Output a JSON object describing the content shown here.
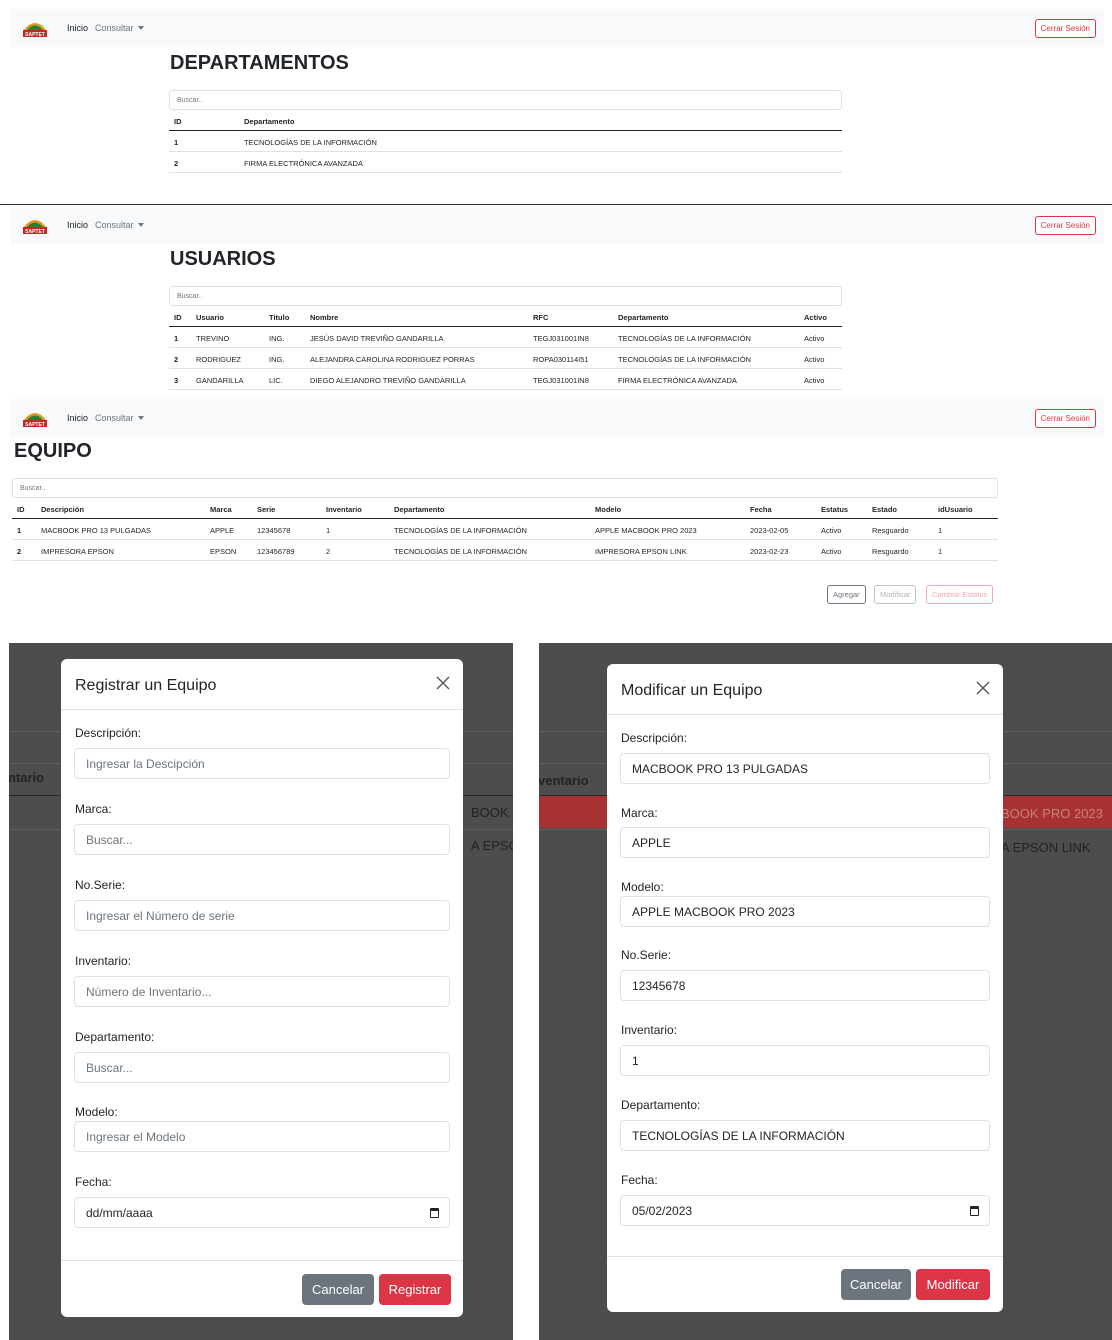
{
  "nav": {
    "logo_text": "SAPTET",
    "home": "Inicio",
    "consult": "Consultar",
    "logout": "Cerrar Sesión"
  },
  "departamentos": {
    "title": "DEPARTAMENTOS",
    "search_placeholder": "Buscar..",
    "headers": [
      "ID",
      "Departamento"
    ],
    "rows": [
      [
        "1",
        "TECNOLOGÍAS DE LA INFORMACIÓN"
      ],
      [
        "2",
        "FIRMA ELECTRÓNICA AVANZADA"
      ]
    ]
  },
  "usuarios": {
    "title": "USUARIOS",
    "search_placeholder": "Buscar..",
    "headers": [
      "ID",
      "Usuario",
      "Titulo",
      "Nombre",
      "RFC",
      "Departamento",
      "Activo"
    ],
    "rows": [
      [
        "1",
        "TREVINO",
        "ING.",
        "JESÚS DAVID TREVIÑO GANDARILLA",
        "TEGJ031001IN8",
        "TECNOLOGÍAS DE LA INFORMACIÓN",
        "Activo"
      ],
      [
        "2",
        "RODRIGUEZ",
        "ING.",
        "ALEJANDRA CAROLINA RODRIGUEZ PORRAS",
        "ROPA030114I51",
        "TECNOLOGÍAS DE LA INFORMACIÓN",
        "Activo"
      ],
      [
        "3",
        "GANDARILLA",
        "LIC.",
        "DIEGO ALEJANDRO TREVIÑO GANDARILLA",
        "TEGJ031001IN8",
        "FIRMA ELECTRÓNICA AVANZADA",
        "Activo"
      ]
    ]
  },
  "equipo": {
    "title": "EQUIPO",
    "search_placeholder": "Buscar..",
    "headers": [
      "ID",
      "Descripción",
      "Marca",
      "Serie",
      "Inventario",
      "Departamento",
      "Modelo",
      "Fecha",
      "Estatus",
      "Estado",
      "idUsuario"
    ],
    "rows": [
      [
        "1",
        "MACBOOK PRO 13 PULGADAS",
        "APPLE",
        "12345678",
        "1",
        "TECNOLOGÍAS DE LA INFORMACIÓN",
        "APPLE MACBOOK PRO 2023",
        "2023-02-05",
        "Activo",
        "Resguardo",
        "1"
      ],
      [
        "2",
        "IMPRESORA EPSON",
        "EPSON",
        "123456789",
        "2",
        "TECNOLOGÍAS DE LA INFORMACIÓN",
        "IMPRESORA EPSON LINK",
        "2023-02-23",
        "Activo",
        "Resguardo",
        "1"
      ]
    ],
    "buttons": {
      "add": "Agregar",
      "edit": "Modificar",
      "status": "Cambiar Estatus"
    }
  },
  "modal_register": {
    "title": "Registrar un Equipo",
    "background": {
      "header": "ntario",
      "row1": "BOOK P",
      "row2": "A EPSON"
    },
    "fields": [
      {
        "label": "Descripción:",
        "placeholder": "Ingresar la Descipción"
      },
      {
        "label": "Marca:",
        "placeholder": "Buscar..."
      },
      {
        "label": "No.Serie:",
        "placeholder": "Ingresar el Número de serie"
      },
      {
        "label": "Inventario:",
        "placeholder": "Número de Inventario..."
      },
      {
        "label": "Departamento:",
        "placeholder": "Buscar..."
      },
      {
        "label": "Modelo:",
        "placeholder": "Ingresar el Modelo"
      },
      {
        "label": "Fecha:",
        "placeholder": "dd/mm/aaaa"
      }
    ],
    "cancel": "Cancelar",
    "submit": "Registrar"
  },
  "modal_edit": {
    "title": "Modificar un Equipo",
    "background": {
      "header": "ventario",
      "row1": "BOOK PRO 2023",
      "row2": "A EPSON LINK"
    },
    "fields": [
      {
        "label": "Descripción:",
        "value": "MACBOOK PRO 13 PULGADAS"
      },
      {
        "label": "Marca:",
        "value": "APPLE"
      },
      {
        "label": "Modelo:",
        "value": "APPLE MACBOOK PRO 2023"
      },
      {
        "label": "No.Serie:",
        "value": "12345678"
      },
      {
        "label": "Inventario:",
        "value": "1"
      },
      {
        "label": "Departamento:",
        "value": "TECNOLOGÍAS DE LA INFORMACIÓN"
      },
      {
        "label": "Fecha:",
        "value": "05/02/2023"
      }
    ],
    "cancel": "Cancelar",
    "submit": "Modificar"
  },
  "colors": {
    "danger": "#dc3545",
    "secondary": "#6c757d",
    "navbar_bg": "#f8f9fa",
    "highlight_row": "#a83232"
  }
}
